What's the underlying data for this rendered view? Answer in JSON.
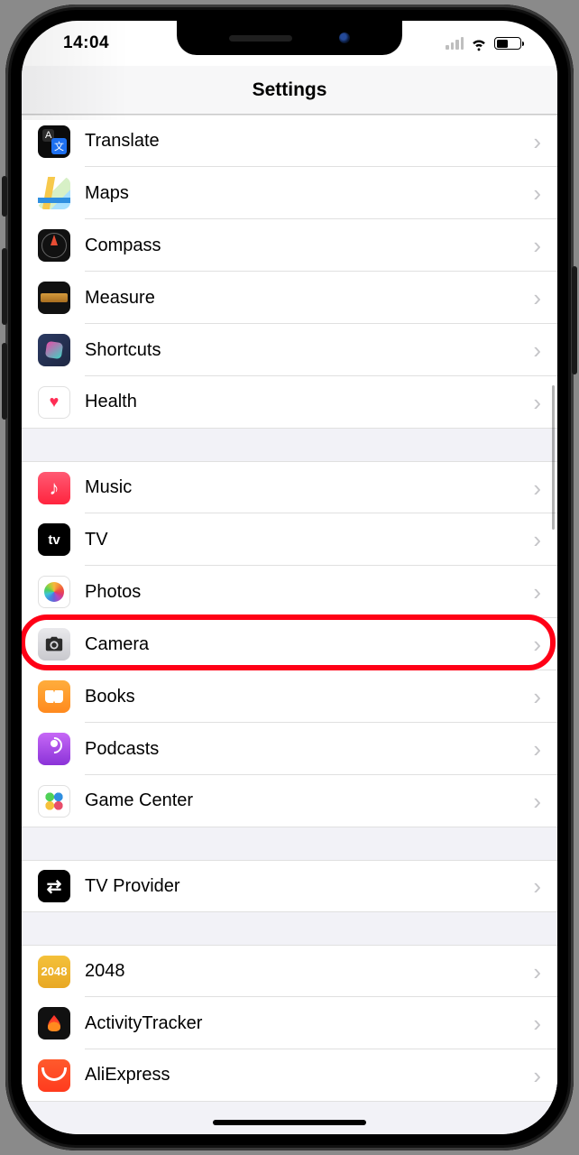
{
  "status": {
    "time": "14:04"
  },
  "header": {
    "title": "Settings"
  },
  "groups": [
    {
      "items": [
        {
          "id": "translate",
          "label": "Translate"
        },
        {
          "id": "maps",
          "label": "Maps"
        },
        {
          "id": "compass",
          "label": "Compass"
        },
        {
          "id": "measure",
          "label": "Measure"
        },
        {
          "id": "shortcuts",
          "label": "Shortcuts"
        },
        {
          "id": "health",
          "label": "Health"
        }
      ]
    },
    {
      "items": [
        {
          "id": "music",
          "label": "Music"
        },
        {
          "id": "tv",
          "label": "TV"
        },
        {
          "id": "photos",
          "label": "Photos"
        },
        {
          "id": "camera",
          "label": "Camera",
          "highlighted": true
        },
        {
          "id": "books",
          "label": "Books"
        },
        {
          "id": "podcasts",
          "label": "Podcasts"
        },
        {
          "id": "gamecenter",
          "label": "Game Center"
        }
      ]
    },
    {
      "items": [
        {
          "id": "tvprovider",
          "label": "TV Provider"
        }
      ]
    },
    {
      "items": [
        {
          "id": "2048",
          "label": "2048"
        },
        {
          "id": "activitytracker",
          "label": "ActivityTracker"
        },
        {
          "id": "aliexpress",
          "label": "AliExpress"
        }
      ]
    }
  ],
  "annotation": {
    "highlight_color": "#ff0016"
  },
  "ic2048": "2048"
}
